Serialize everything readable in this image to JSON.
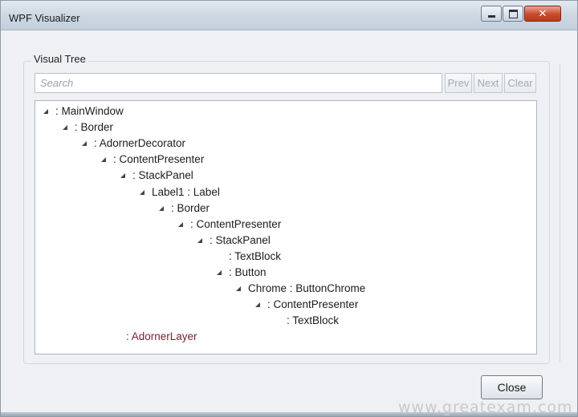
{
  "window": {
    "title": "WPF Visualizer"
  },
  "visual_tree": {
    "group_label": "Visual Tree",
    "search": {
      "placeholder": "Search",
      "value": ""
    },
    "buttons": {
      "prev": "Prev",
      "next": "Next",
      "clear": "Clear"
    },
    "items": [
      {
        "text": ": MainWindow",
        "depth": 0,
        "expanded": true
      },
      {
        "text": ": Border",
        "depth": 1,
        "expanded": true
      },
      {
        "text": ": AdornerDecorator",
        "depth": 2,
        "expanded": true
      },
      {
        "text": ": ContentPresenter",
        "depth": 3,
        "expanded": true
      },
      {
        "text": ": StackPanel",
        "depth": 4,
        "expanded": true
      },
      {
        "text": "Label1 : Label",
        "depth": 5,
        "expanded": true
      },
      {
        "text": ": Border",
        "depth": 6,
        "expanded": true
      },
      {
        "text": ": ContentPresenter",
        "depth": 7,
        "expanded": true
      },
      {
        "text": ": StackPanel",
        "depth": 8,
        "expanded": true
      },
      {
        "text": ": TextBlock",
        "depth": 9,
        "expanded": false
      },
      {
        "text": ": Button",
        "depth": 9,
        "expanded": true
      },
      {
        "text": "Chrome : ButtonChrome",
        "depth": 10,
        "expanded": true
      },
      {
        "text": ": ContentPresenter",
        "depth": 11,
        "expanded": true
      },
      {
        "text": ": TextBlock",
        "depth": 12,
        "expanded": false
      },
      {
        "text": ": AdornerLayer",
        "depth": 3,
        "expanded": false,
        "highlighted": true
      }
    ]
  },
  "footer": {
    "close_label": "Close"
  },
  "watermark": "www.greatexam.com",
  "colors": {
    "highlight_text": "#7a2030",
    "close_button_red": "#c84a2c"
  }
}
